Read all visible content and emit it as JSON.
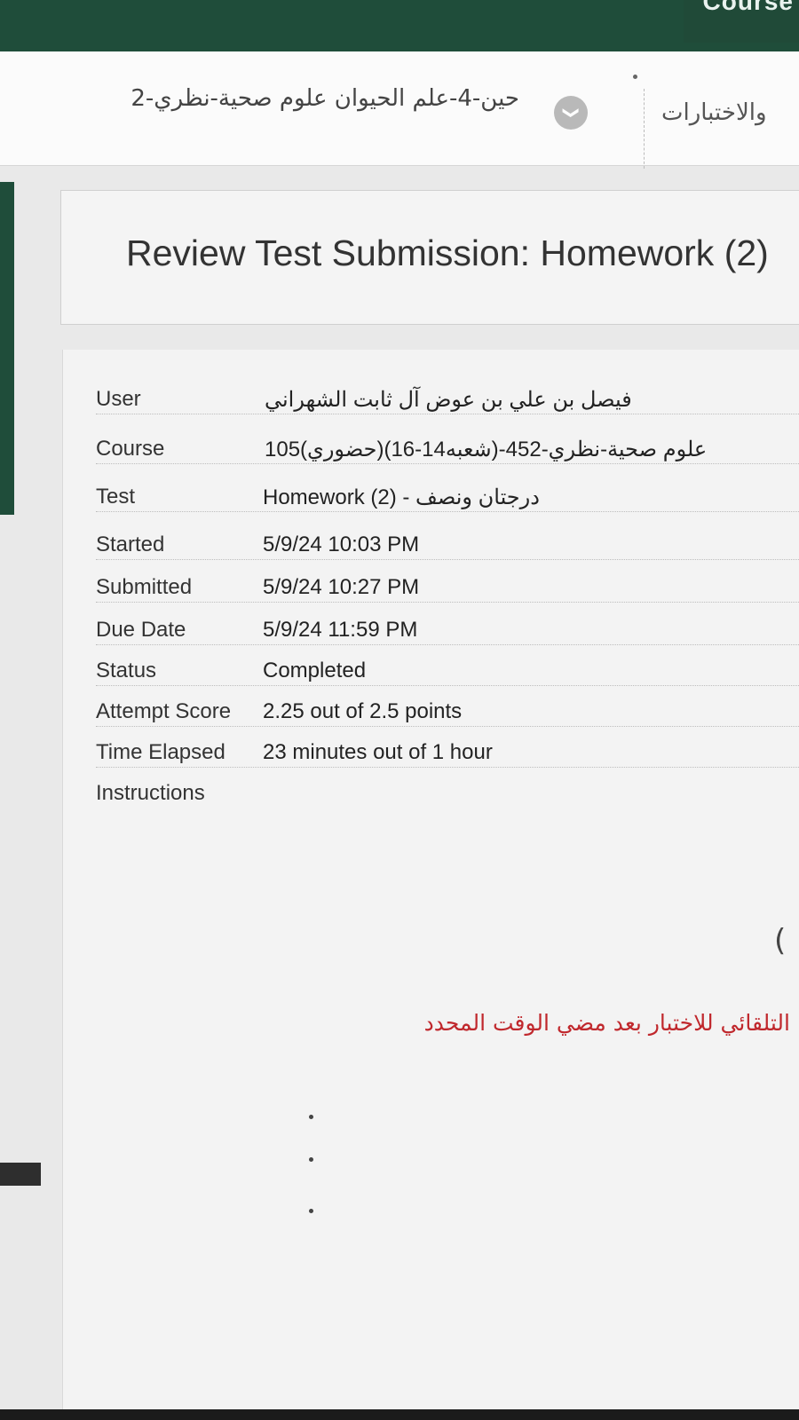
{
  "header": {
    "courses_label": "Course",
    "breadcrumb_tests": "والاختبارات",
    "breadcrumb_course": "حين-4-علم الحيوان علوم صحية-نظري-2"
  },
  "page": {
    "title": "Review Test Submission: Homework (2)"
  },
  "details": {
    "user_label": "User",
    "user_value": "فيصل بن علي بن عوض آل ثابت الشهراني",
    "course_label": "Course",
    "course_value": "علوم صحية-نظري-452-(شعبه14-16)(حضوري)105",
    "test_label": "Test",
    "test_value": "Homework (2) - درجتان ونصف",
    "started_label": "Started",
    "started_value": "5/9/24 10:03 PM",
    "submitted_label": "Submitted",
    "submitted_value": "5/9/24 10:27 PM",
    "due_label": "Due Date",
    "due_value": "5/9/24 11:59 PM",
    "status_label": "Status",
    "status_value": "Completed",
    "score_label": "Attempt Score",
    "score_value": "2.25 out of 2.5 points",
    "elapsed_label": "Time Elapsed",
    "elapsed_value": "23 minutes out of 1 hour",
    "instructions_label": "Instructions"
  },
  "instructions": {
    "note": "التلقائي للاختبار بعد مضي الوقت المحدد"
  },
  "colors": {
    "brand_green": "#1f4d3a",
    "note_red": "#c0282d"
  }
}
